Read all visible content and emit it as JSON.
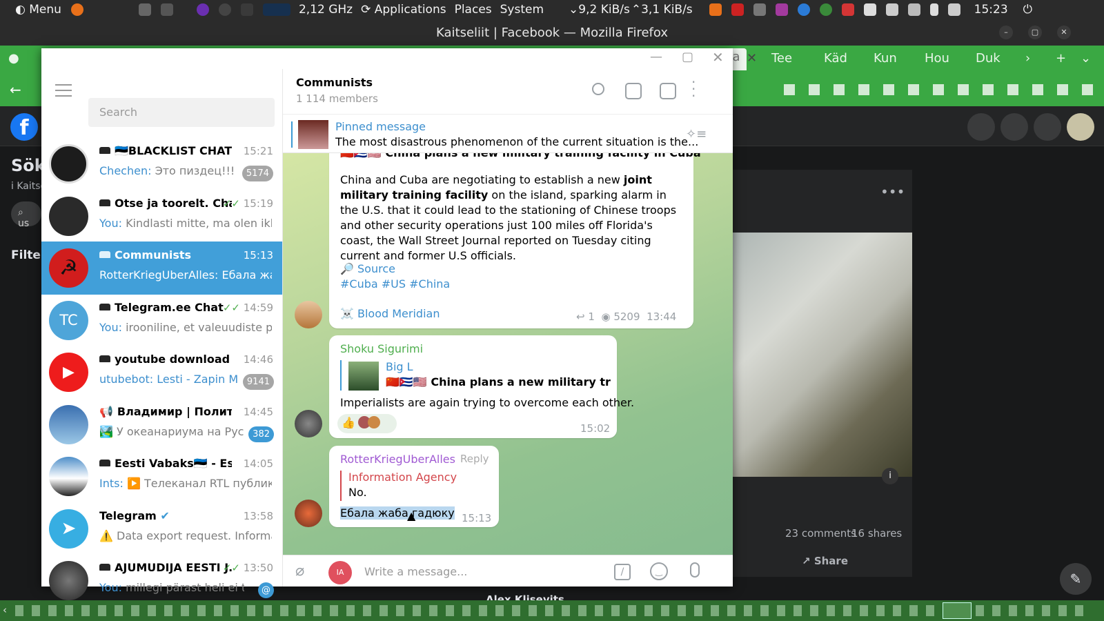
{
  "topbar": {
    "menu": "Menu",
    "cpu": "2,12 GHz",
    "applications": "Applications",
    "places": "Places",
    "system": "System",
    "net_down": "9,2 KiB/s",
    "net_up": "3,1 KiB/s",
    "clock": "15:23"
  },
  "firefox": {
    "window_title": "Kaitseliit | Facebook — Mozilla Firefox",
    "tabs": [
      "Ka",
      "Tee",
      "Käd",
      "Kun",
      "Hou",
      "Duk"
    ]
  },
  "facebook": {
    "page_title_partial": "Sök",
    "subtitle_partial": "i Kaitse",
    "search_partial": "us",
    "filter_partial": "Filter",
    "comments": "23 comments",
    "shares": "16 shares",
    "share_label": "Share",
    "next_author_partial": "Alex Klisevits"
  },
  "telegram": {
    "search_placeholder": "Search",
    "chats": [
      {
        "name": "🇪🇪BLACKLIST CHAT🇪🇪",
        "time": "15:21",
        "sender": "Chechen:",
        "preview": "Это пиздец!!!",
        "badge": "5174",
        "avatar_color": "#1c1c1c"
      },
      {
        "name": "Otse ja toorelt. Chat",
        "time": "15:19",
        "sender": "You:",
        "preview": "Kindlasti mitte, ma olen ikka...",
        "badge": "",
        "avatar_color": "#2a2a2a"
      },
      {
        "name": "Communists",
        "time": "15:13",
        "sender": "",
        "preview": "RotterKriegUberAlles: Ебала жаб...",
        "badge": "",
        "avatar_color": "#d11d1d"
      },
      {
        "name": "Telegram.ee Chat",
        "time": "14:59",
        "sender": "You:",
        "preview": "irooniline, et valeuudiste pr...",
        "badge": "",
        "avatar_color": "#4ea5d9",
        "initials": "TC"
      },
      {
        "name": "youtube download",
        "time": "14:46",
        "sender": "utubebot:",
        "preview": "Lesti - Zapin M...",
        "badge": "9141",
        "avatar_color": "#ee1c1c"
      },
      {
        "name": "Владимир | Политик...",
        "time": "14:45",
        "sender": "",
        "preview": "🏞️ У океанариума на Рус...",
        "badge": "382",
        "avatar_color": "#3a6fb0"
      },
      {
        "name": "Eesti Vabaks🇪🇪 - Esto...",
        "time": "14:05",
        "sender": "Ints:",
        "preview": "▶️ Телеканал RTL публику...",
        "badge": "",
        "avatar_color": "#4e8fc9"
      },
      {
        "name": "Telegram",
        "time": "13:58",
        "sender": "",
        "preview": "⚠️ Data export request. Informa...",
        "badge": "",
        "avatar_color": "#37aee2"
      },
      {
        "name": "AJUMUDIJA EESTI J...",
        "time": "13:50",
        "sender": "You:",
        "preview": "millegi pärast heli ei tul...",
        "badge": "@",
        "avatar_color": "#555"
      }
    ],
    "chat_title": "Communists",
    "chat_members": "1 114 members",
    "pinned_label": "Pinned message",
    "pinned_text": "The most disastrous phenomenon of the current situation is the...",
    "msg1": {
      "cut_heading": "🇨🇳🇨🇺🇺🇸 China plans a new military training facility in Cuba",
      "text_a": "China and Cuba are negotiating to establish a new ",
      "bold_a": "joint military training facility",
      "text_b": " on the island, sparking alarm in the U.S. that it could lead to the stationing of Chinese troops and other security operations just 100 miles off Florida's coast, the Wall Street Journal reported on Tuesday citing current and former U.S officials.",
      "source": "🔎 Source",
      "tags": "#Cuba #US #China",
      "signature": "☠️ Blood Meridian",
      "replies": "1",
      "views": "5209",
      "time": "13:44"
    },
    "msg2": {
      "author": "Shoku Sigurimi",
      "reply_author": "Big L",
      "reply_text": "🇨🇳🇨🇺🇺🇸 China plans a new military trai...",
      "text": "Imperialists are again trying to overcome each other.",
      "reaction": "👍",
      "time": "15:02"
    },
    "msg3": {
      "author": "RotterKriegUberAlles",
      "reply_link": "Reply",
      "reply_author": "Information Agency",
      "reply_text": "No.",
      "text": "Ебала жаба гадюку",
      "time": "15:13"
    },
    "composer_placeholder": "Write a message...",
    "user_initials": "IA"
  }
}
